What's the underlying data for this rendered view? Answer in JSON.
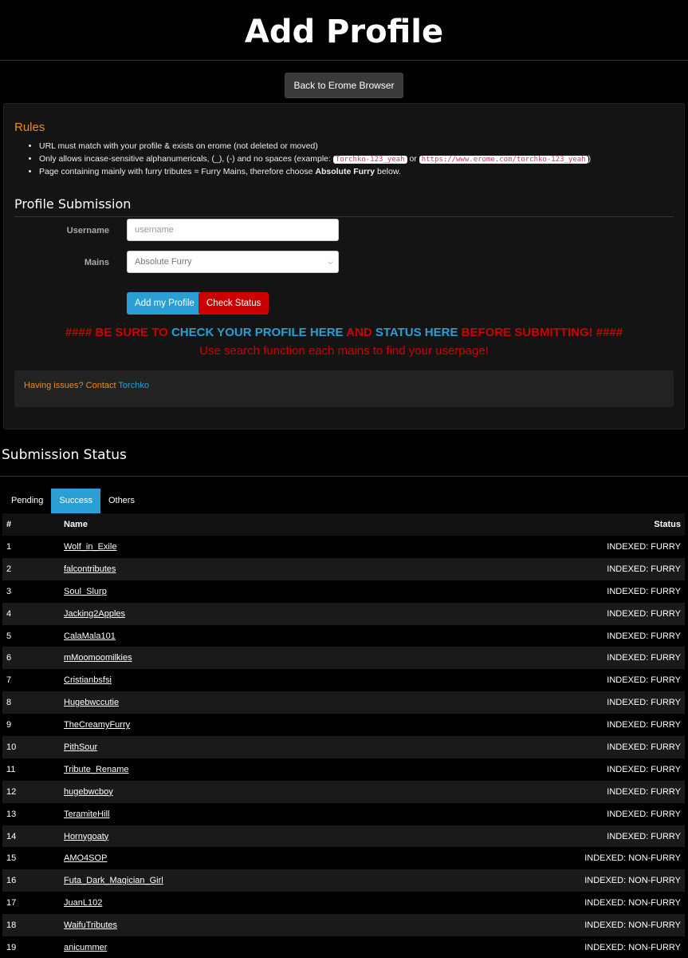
{
  "header": {
    "title": "Add Profile",
    "back_button": "Back to Erome Browser"
  },
  "rules": {
    "title": "Rules",
    "item1": "URL must match with your profile & exists on erome (not deleted or moved)",
    "item2_pre": "Only allows incase-sensitive alphanumericals, (_), (-) and no spaces (example: ",
    "item2_code1": "Torchko-123_yeah",
    "item2_mid": " or ",
    "item2_code2": "https://www.erome.com/torchko-123_yeah",
    "item2_post": ")",
    "item3_pre": "Page containing mainly with furry tributes = Furry Mains, therefore choose ",
    "item3_bold": "Absolute Furry",
    "item3_post": " below."
  },
  "form": {
    "title": "Profile Submission",
    "username_label": "Username",
    "username_placeholder": "username",
    "mains_label": "Mains",
    "mains_value": "Absolute Furry",
    "add_button": "Add my Profile",
    "check_button": "Check Status"
  },
  "warning": {
    "p1": "#### BE SURE TO ",
    "p2": "CHECK YOUR PROFILE HERE",
    "p3": " AND ",
    "p4": "STATUS HERE",
    "p5": " BEFORE SUBMITTING! ####",
    "line2": "Use search function each mains to find your userpage!"
  },
  "issues": {
    "text": "Having issues? Contact ",
    "link": "Torchko"
  },
  "status": {
    "title": "Submission Status",
    "tabs": [
      "Pending",
      "Success",
      "Others"
    ],
    "active_tab": "Success",
    "columns": [
      "#",
      "Name",
      "Status"
    ],
    "rows": [
      {
        "n": "1",
        "name": "Wolf_in_Exile",
        "status": "INDEXED: FURRY"
      },
      {
        "n": "2",
        "name": "falcontributes",
        "status": "INDEXED: FURRY"
      },
      {
        "n": "3",
        "name": "Soul_Slurp",
        "status": "INDEXED: FURRY"
      },
      {
        "n": "4",
        "name": "Jacking2Apples",
        "status": "INDEXED: FURRY"
      },
      {
        "n": "5",
        "name": "CalaMala101",
        "status": "INDEXED: FURRY"
      },
      {
        "n": "6",
        "name": "mMoomoomilkies",
        "status": "INDEXED: FURRY"
      },
      {
        "n": "7",
        "name": "Cristianbsfsi",
        "status": "INDEXED: FURRY"
      },
      {
        "n": "8",
        "name": "Hugebwccutie",
        "status": "INDEXED: FURRY"
      },
      {
        "n": "9",
        "name": "TheCreamyFurry",
        "status": "INDEXED: FURRY"
      },
      {
        "n": "10",
        "name": "PithSour",
        "status": "INDEXED: FURRY"
      },
      {
        "n": "11",
        "name": "Tribute_Rename",
        "status": "INDEXED: FURRY"
      },
      {
        "n": "12",
        "name": "hugebwcboy",
        "status": "INDEXED: FURRY"
      },
      {
        "n": "13",
        "name": "TeramiteHill",
        "status": "INDEXED: FURRY"
      },
      {
        "n": "14",
        "name": "Hornygoaty",
        "status": "INDEXED: FURRY"
      },
      {
        "n": "15",
        "name": "AMO4SOP",
        "status": "INDEXED: NON-FURRY"
      },
      {
        "n": "16",
        "name": "Futa_Dark_Magician_Girl",
        "status": "INDEXED: NON-FURRY"
      },
      {
        "n": "17",
        "name": "JuanL102",
        "status": "INDEXED: NON-FURRY"
      },
      {
        "n": "18",
        "name": "WaifuTributes",
        "status": "INDEXED: NON-FURRY"
      },
      {
        "n": "19",
        "name": "anicummer",
        "status": "INDEXED: NON-FURRY"
      }
    ]
  }
}
